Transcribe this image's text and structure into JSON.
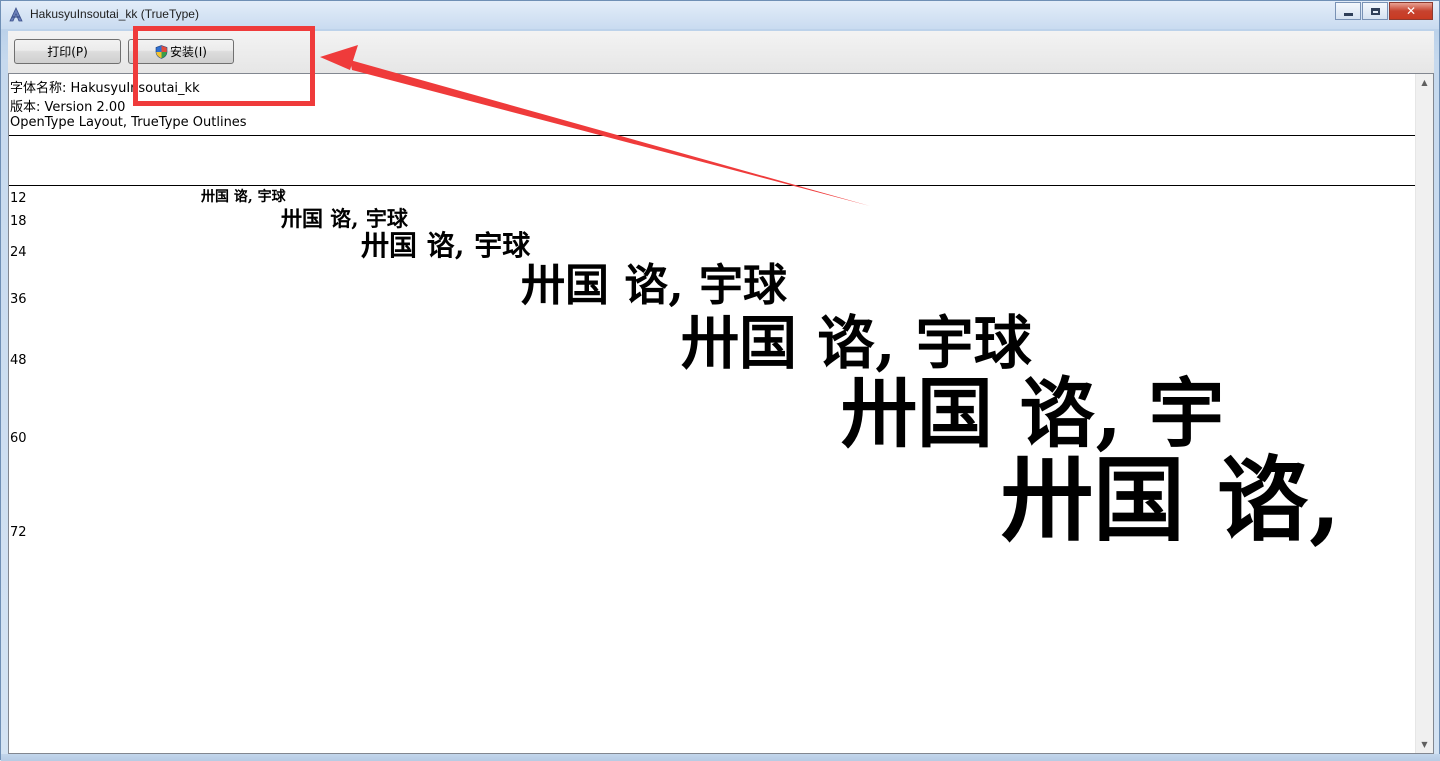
{
  "window": {
    "title": "HakusyuInsoutai_kk (TrueType)",
    "app_icon": "font-viewer-icon",
    "caption": {
      "minimize_glyph": "",
      "close_glyph": "✕"
    }
  },
  "toolbar": {
    "print_label": "打印(P)",
    "install_label": "安装(I)"
  },
  "font_info": {
    "name_line": "字体名称: HakusyuInsoutai_kk",
    "version_line": "版本: Version 2.00",
    "type_line": "OpenType Layout, TrueType Outlines"
  },
  "samples": [
    {
      "size": "12",
      "text": "卅国  谘,     宇球"
    },
    {
      "size": "18",
      "text": "卅国  谘,     宇球"
    },
    {
      "size": "24",
      "text": "卅国  谘,     宇球"
    },
    {
      "size": "36",
      "text": "卅国  谘,     宇球"
    },
    {
      "size": "48",
      "text": "卅国  谘,     宇球"
    },
    {
      "size": "60",
      "text": "卅国  谘,     宇"
    },
    {
      "size": "72",
      "text": "卅国  谘,"
    }
  ],
  "colors": {
    "annotation": "#ef3b3b",
    "content_bg": "#ffffff",
    "frame": "#c9dbf0"
  }
}
